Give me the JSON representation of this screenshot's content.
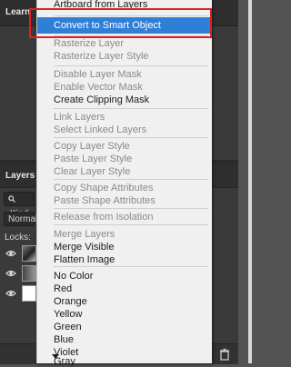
{
  "panels": {
    "learn_tab": "Learn",
    "layers_tab": "Layers",
    "filter_kind": "Kind",
    "blend_mode": "Normal",
    "locks_label": "Locks:"
  },
  "menu": {
    "top_partial": "Artboard from Layers",
    "items": {
      "convert_smart_object": "Convert to Smart Object",
      "rasterize_layer": "Rasterize Layer",
      "rasterize_layer_style": "Rasterize Layer Style",
      "disable_layer_mask": "Disable Layer Mask",
      "enable_vector_mask": "Enable Vector Mask",
      "create_clipping_mask": "Create Clipping Mask",
      "link_layers": "Link Layers",
      "select_linked_layers": "Select Linked Layers",
      "copy_layer_style": "Copy Layer Style",
      "paste_layer_style": "Paste Layer Style",
      "clear_layer_style": "Clear Layer Style",
      "copy_shape_attributes": "Copy Shape Attributes",
      "paste_shape_attributes": "Paste Shape Attributes",
      "release_from_isolation": "Release from Isolation",
      "merge_layers": "Merge Layers",
      "merge_visible": "Merge Visible",
      "flatten_image": "Flatten Image"
    },
    "colors": {
      "no_color": "No Color",
      "red": "Red",
      "orange": "Orange",
      "yellow": "Yellow",
      "green": "Green",
      "blue": "Blue",
      "violet": "Violet",
      "gray": "Gray"
    }
  },
  "theme": {
    "highlight_color": "#2f7fd7",
    "annotation_color": "#e02020"
  }
}
